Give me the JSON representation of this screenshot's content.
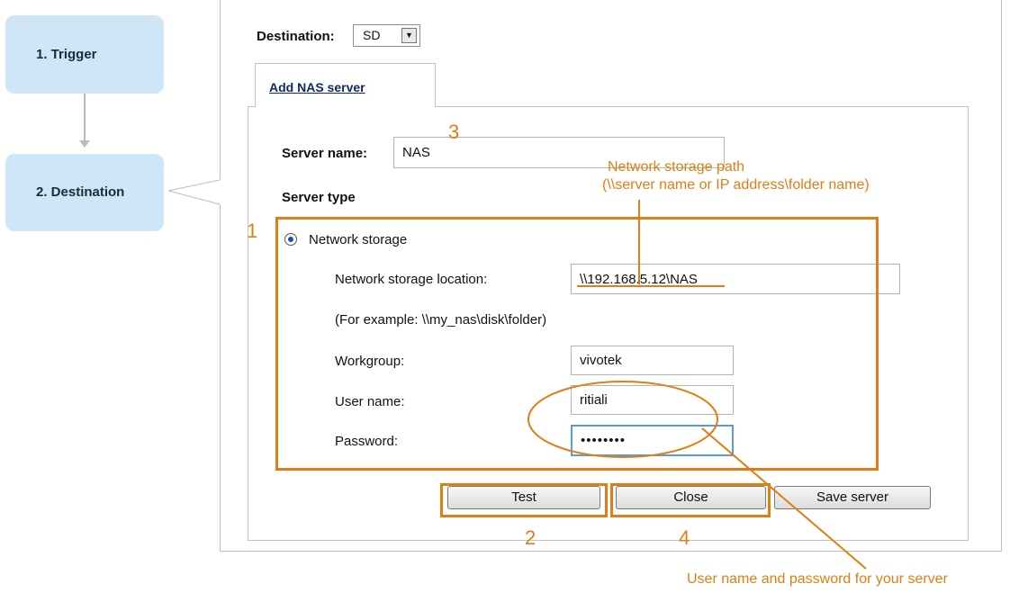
{
  "steps": {
    "trigger": "1. Trigger",
    "destination": "2. Destination"
  },
  "destination": {
    "label": "Destination:",
    "selected": "SD"
  },
  "tab": {
    "label": "Add NAS server"
  },
  "form": {
    "server_name_label": "Server name:",
    "server_name_value": "NAS",
    "server_type_label": "Server type",
    "network_storage_label": "Network storage",
    "location_label": "Network storage location:",
    "location_value": "\\\\192.168.5.12\\NAS",
    "example_text": "(For example: \\\\my_nas\\disk\\folder)",
    "workgroup_label": "Workgroup:",
    "workgroup_value": "vivotek",
    "username_label": "User name:",
    "username_value": "ritiali",
    "password_label": "Password:",
    "password_value": "••••••••"
  },
  "buttons": {
    "test": "Test",
    "close": "Close",
    "save": "Save server"
  },
  "annotations": {
    "n1": "1",
    "n2": "2",
    "n3": "3",
    "n4": "4",
    "path_note_line1": "Network storage path",
    "path_note_line2": "(\\\\server name or IP address\\folder name)",
    "credentials_note": "User name and password for your server",
    "accent_color": "#e07d14"
  }
}
